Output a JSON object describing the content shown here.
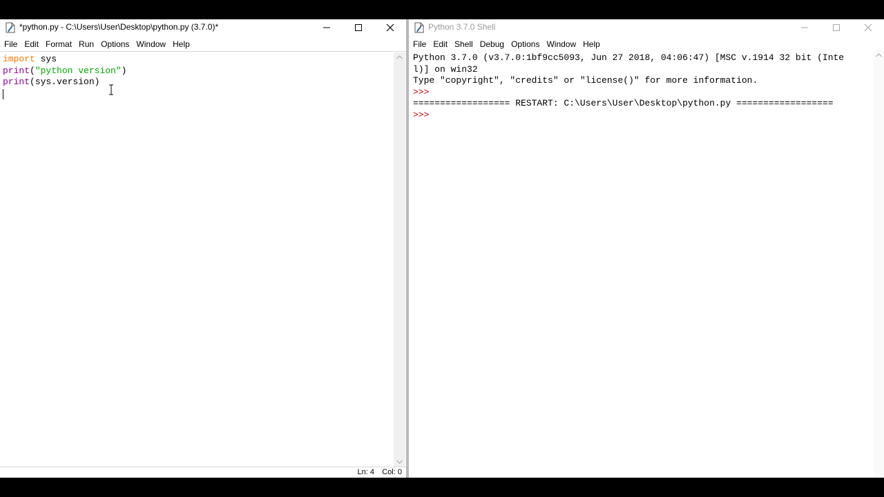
{
  "editor": {
    "title": "*python.py - C:\\Users\\User\\Desktop\\python.py (3.7.0)*",
    "menu": [
      "File",
      "Edit",
      "Format",
      "Run",
      "Options",
      "Window",
      "Help"
    ],
    "code": {
      "line1_kw": "import",
      "line1_rest": " sys",
      "line2_fn": "print",
      "line2_open": "(",
      "line2_str": "\"python version\"",
      "line2_close": ")",
      "line3_fn": "print",
      "line3_rest": "(sys.version)"
    },
    "status": {
      "ln": "Ln: 4",
      "col": "Col: 0"
    }
  },
  "shell": {
    "title": "Python 3.7.0 Shell",
    "menu": [
      "File",
      "Edit",
      "Shell",
      "Debug",
      "Options",
      "Window",
      "Help"
    ],
    "lines": {
      "banner1": "Python 3.7.0 (v3.7.0:1bf9cc5093, Jun 27 2018, 04:06:47) [MSC v.1914 32 bit (Inte",
      "banner2": "l)] on win32",
      "banner3": "Type \"copyright\", \"credits\" or \"license()\" for more information.",
      "prompt1": ">>> ",
      "restart": "================== RESTART: C:\\Users\\User\\Desktop\\python.py ==================",
      "prompt2": ">>> "
    }
  },
  "icons": {
    "app": "idle-icon",
    "minimize": "minimize-icon",
    "maximize": "maximize-icon",
    "close": "close-icon",
    "scroll_up": "scroll-up-arrow-icon",
    "scroll_down": "scroll-down-arrow-icon",
    "cursor": "text-ibeam-cursor-icon"
  },
  "colors": {
    "keyword": "#ff7700",
    "builtin": "#900090",
    "string": "#00aa00",
    "prompt": "#c00000"
  }
}
